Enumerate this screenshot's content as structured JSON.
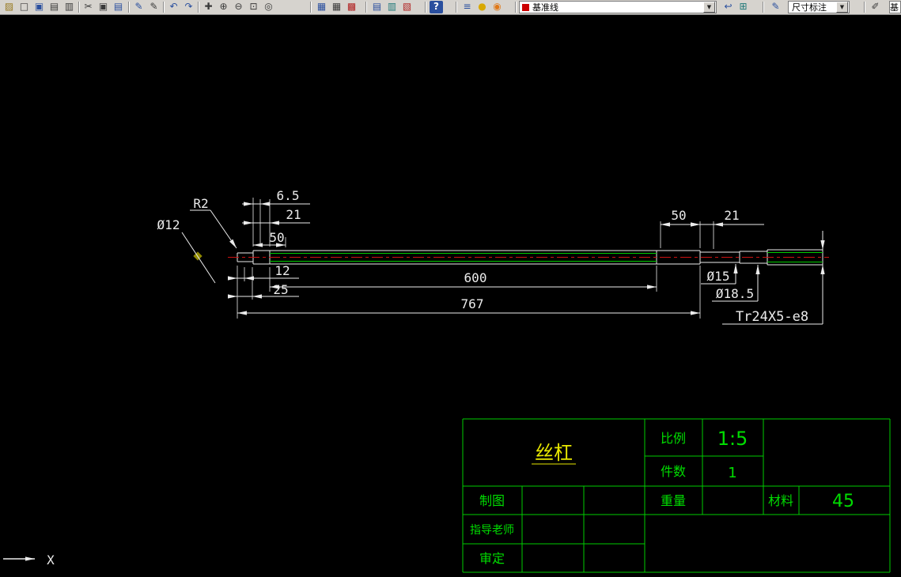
{
  "colors": {
    "canvas": "#000000",
    "toolbar-bg": "#d6d3ce",
    "line-white": "#ebebeb",
    "line-green": "#00cc00",
    "line-red": "#cc1111",
    "text-green": "#00dd00",
    "text-yellow": "#e8e800",
    "marker-olive": "#918a00",
    "swatch-red": "#cc0000"
  },
  "toolbar": {
    "icons": [
      {
        "name": "open-icon",
        "glyph": "▨"
      },
      {
        "name": "new-icon",
        "glyph": "□"
      },
      {
        "name": "save-icon",
        "glyph": "▣"
      },
      {
        "name": "plot-icon",
        "glyph": "▤"
      },
      {
        "name": "preview-icon",
        "glyph": "▥"
      },
      {
        "name": "cut-icon",
        "glyph": "✂"
      },
      {
        "name": "copy-icon",
        "glyph": "▣"
      },
      {
        "name": "paste-icon",
        "glyph": "▤"
      },
      {
        "name": "matchprop-icon",
        "glyph": "✎"
      },
      {
        "name": "pencil-icon",
        "glyph": "✎"
      },
      {
        "name": "undo-icon",
        "glyph": "↶"
      },
      {
        "name": "redo-icon",
        "glyph": "↷"
      },
      {
        "name": "pan-icon",
        "glyph": "✚"
      },
      {
        "name": "zoom-in-icon",
        "glyph": "⊕"
      },
      {
        "name": "zoom-out-icon",
        "glyph": "⊖"
      },
      {
        "name": "zoom-window-icon",
        "glyph": "⊡"
      },
      {
        "name": "zoom-previous-icon",
        "glyph": "◎"
      },
      {
        "name": "sheetset-icon",
        "glyph": "▦"
      },
      {
        "name": "table-icon",
        "glyph": "▦"
      },
      {
        "name": "markup-icon",
        "glyph": "▩"
      },
      {
        "name": "properties-icon",
        "glyph": "▤"
      },
      {
        "name": "designcenter-icon",
        "glyph": "▥"
      },
      {
        "name": "palettes-icon",
        "glyph": "▧"
      },
      {
        "name": "help-icon",
        "glyph": "?"
      },
      {
        "name": "layers-icon",
        "glyph": "≡"
      },
      {
        "name": "bulb-icon",
        "glyph": "●"
      },
      {
        "name": "sun-icon",
        "glyph": "◉"
      },
      {
        "name": "layer-previous-icon",
        "glyph": "↩"
      },
      {
        "name": "make-object-layer-icon",
        "glyph": "⊞"
      },
      {
        "name": "dimstyle-icon",
        "glyph": "✎"
      },
      {
        "name": "dimedit-icon",
        "glyph": "✐"
      }
    ],
    "chevron_glyph": "▼",
    "layer_combo_value": "基准线",
    "dim_combo_value": "尺寸标注",
    "overflow_label": "基"
  },
  "drawing": {
    "dimensions": {
      "fillet_radius": "R2",
      "dia_left": "Ø12",
      "len_6_5": "6.5",
      "len_21_left": "21",
      "len_50_left": "50",
      "len_12": "12",
      "len_25": "25",
      "len_600": "600",
      "len_767": "767",
      "len_50_right": "50",
      "len_21_right": "21",
      "dia_15": "Ø15",
      "dia_18_5": "Ø18.5",
      "thread_spec": "Tr24X5-e8"
    },
    "ucs_x_label": "X"
  },
  "title_block": {
    "part_name": "丝杠",
    "scale_label": "比例",
    "scale_value": "1:5",
    "quantity_label": "件数",
    "quantity_value": "1",
    "drafter_label": "制图",
    "weight_label": "重量",
    "material_label": "材料",
    "material_value": "45",
    "advisor_label": "指导老师",
    "reviewer_label": "审定"
  }
}
